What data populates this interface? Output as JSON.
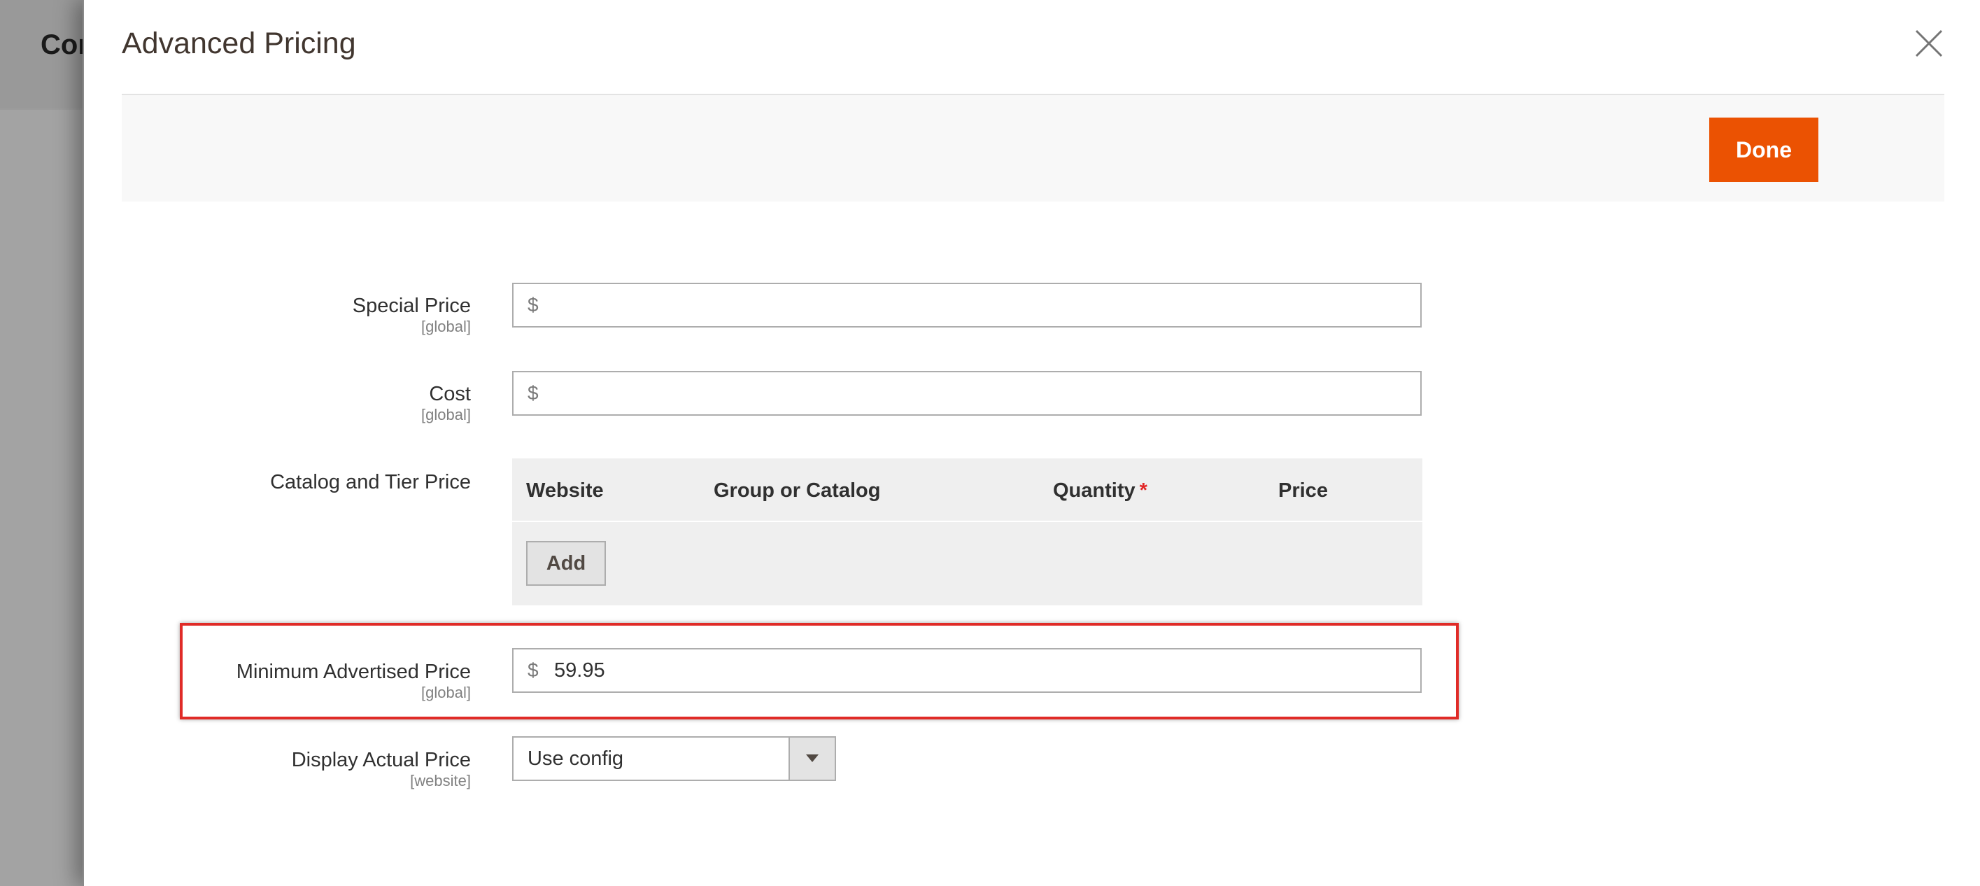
{
  "background": {
    "title": "Cor"
  },
  "modal": {
    "title": "Advanced Pricing",
    "done_label": "Done",
    "close_icon": "close-icon"
  },
  "fields": {
    "special_price": {
      "label": "Special Price",
      "scope": "[global]",
      "currency": "$",
      "value": ""
    },
    "cost": {
      "label": "Cost",
      "scope": "[global]",
      "currency": "$",
      "value": ""
    },
    "tier_price": {
      "label": "Catalog and Tier Price",
      "columns": [
        "Website",
        "Group or Catalog",
        "Quantity",
        "Price"
      ],
      "required_marker": "*",
      "add_label": "Add"
    },
    "map": {
      "label": "Minimum Advertised Price",
      "scope": "[global]",
      "currency": "$",
      "value": "59.95"
    },
    "display_actual_price": {
      "label": "Display Actual Price",
      "scope": "[website]",
      "selected": "Use config"
    }
  },
  "colors": {
    "accent": "#eb5202",
    "highlight": "#e02b27",
    "required": "#e22626"
  }
}
